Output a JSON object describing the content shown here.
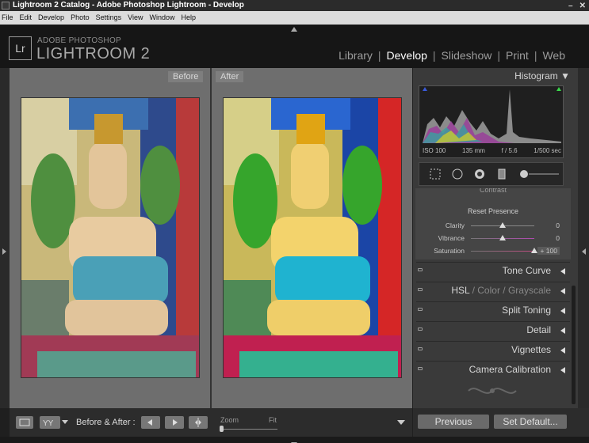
{
  "window": {
    "title": "Lightroom 2 Catalog - Adobe Photoshop Lightroom - Develop"
  },
  "menu": [
    "File",
    "Edit",
    "Develop",
    "Photo",
    "Settings",
    "View",
    "Window",
    "Help"
  ],
  "brand": {
    "badge": "Lr",
    "top": "ADOBE PHOTOSHOP",
    "name": "LIGHTROOM 2"
  },
  "modules": [
    {
      "label": "Library",
      "active": false
    },
    {
      "label": "Develop",
      "active": true
    },
    {
      "label": "Slideshow",
      "active": false
    },
    {
      "label": "Print",
      "active": false
    },
    {
      "label": "Web",
      "active": false
    }
  ],
  "compare": {
    "before_label": "Before",
    "after_label": "After"
  },
  "histogram": {
    "title": "Histogram",
    "iso": "ISO 100",
    "focal": "135 mm",
    "aperture": "f / 5.6",
    "shutter": "1/500 sec"
  },
  "presence": {
    "contrast_label": "Contrast",
    "reset_label": "Reset Presence",
    "sliders": [
      {
        "label": "Clarity",
        "value": "0",
        "fraction": 0.5
      },
      {
        "label": "Vibrance",
        "value": "0",
        "fraction": 0.5
      },
      {
        "label": "Saturation",
        "value": "+ 100",
        "fraction": 1.0
      }
    ]
  },
  "sections": [
    {
      "label": "Tone Curve"
    },
    {
      "label": "HSL",
      "extra1": "Color",
      "extra2": "Grayscale"
    },
    {
      "label": "Split Toning"
    },
    {
      "label": "Detail"
    },
    {
      "label": "Vignettes"
    },
    {
      "label": "Camera Calibration"
    }
  ],
  "bottom": {
    "before_after_label": "Before & After :",
    "zoom_label": "Zoom",
    "fit_label": "Fit",
    "previous_label": "Previous",
    "set_default_label": "Set Default..."
  },
  "colors": {
    "active_module": "#ffffff",
    "panel_bg": "#3a3a3a",
    "view_bg": "#6e6e6e"
  }
}
